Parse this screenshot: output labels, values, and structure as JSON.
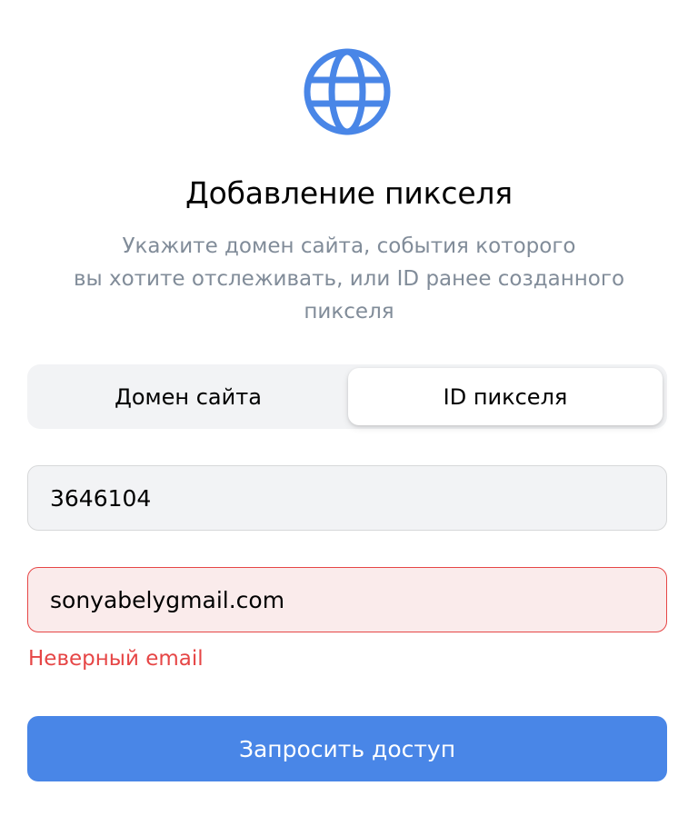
{
  "header": {
    "icon": "globe-icon",
    "title": "Добавление пикселя",
    "subtitle_lines": [
      "Укажите домен сайта, события которого",
      "вы хотите отслеживать, или ID ранее созданного",
      "пикселя"
    ]
  },
  "tabs": {
    "items": [
      {
        "label": "Домен сайта",
        "active": false
      },
      {
        "label": "ID пикселя",
        "active": true
      }
    ]
  },
  "form": {
    "pixel_id_value": "3646104",
    "email_value": "sonyabelygmail.com",
    "email_error": "Неверный email",
    "submit_label": "Запросить доступ"
  },
  "colors": {
    "accent": "#4986e7",
    "error": "#e64646",
    "error_bg": "#faebeb",
    "muted_text": "#818c99",
    "field_bg": "#f2f3f5"
  }
}
